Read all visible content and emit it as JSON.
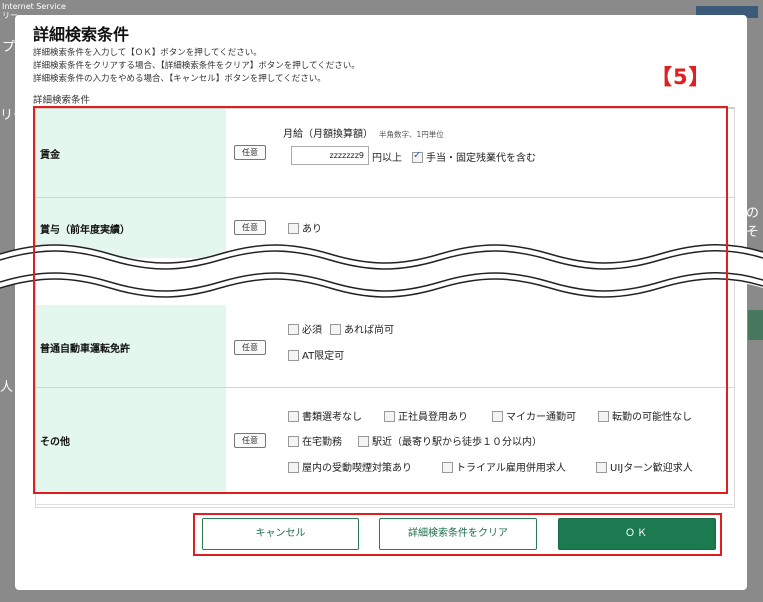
{
  "background": {
    "brand_line1": "Internet Service",
    "brand_line2": "リー",
    "frag_left1": "プ",
    "frag_left2": "リー",
    "frag_left3": "人",
    "frag_right": "のそ"
  },
  "dialog": {
    "title": "詳細検索条件",
    "instructions": [
      "詳細検索条件を入力して【ＯＫ】ボタンを押してください。",
      "詳細検索条件をクリアする場合、【詳細検索条件をクリア】ボタンを押してください。",
      "詳細検索条件の入力をやめる場合、【キャンセル】ボタンを押してください。"
    ],
    "section_label": "詳細検索条件",
    "callout": "【5】",
    "optional_badge": "任意"
  },
  "rows": {
    "wage": {
      "label": "賃金",
      "sublabel": "月給（月額換算額）",
      "hint": "半角数字、1円単位",
      "input_value": "zzzzzzz9",
      "unit": "円以上",
      "allowance_label": "手当・固定残業代を含む",
      "allowance_checked": true
    },
    "bonus": {
      "label": "賞与（前年度実績）",
      "option": "あり"
    },
    "license": {
      "label": "普通自動車運転免許",
      "options": [
        "必須",
        "あれば尚可",
        "AT限定可"
      ]
    },
    "other": {
      "label": "その他",
      "options": [
        "書類選考なし",
        "正社員登用あり",
        "マイカー通勤可",
        "転勤の可能性なし",
        "在宅勤務",
        "駅近（最寄り駅から徒歩１０分以内）",
        "屋内の受動喫煙対策あり",
        "トライアル雇用併用求人",
        "UIJターン歓迎求人"
      ]
    }
  },
  "buttons": {
    "cancel": "キャンセル",
    "clear": "詳細検索条件をクリア",
    "ok": "ＯＫ"
  },
  "colors": {
    "accent": "#1b7a4f",
    "row_header": "#e3f7ee",
    "callout": "#e01e1e"
  }
}
